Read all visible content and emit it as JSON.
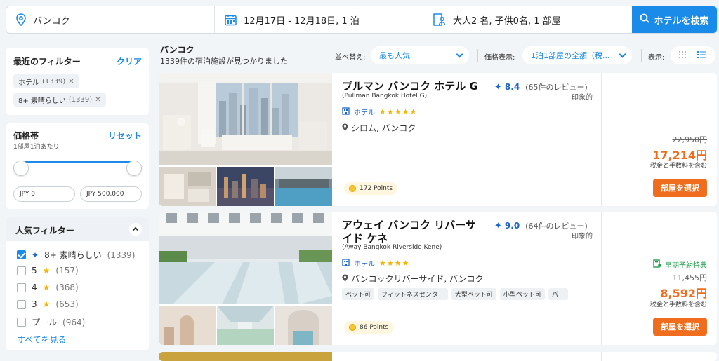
{
  "search": {
    "destination": "バンコク",
    "dates": "12月17日 - 12月18日, 1 泊",
    "guests": "大人2 名, 子供0名, 1 部屋",
    "button": "ホテルを検索"
  },
  "sidebar": {
    "recent_filters": {
      "title": "最近のフィルター",
      "clear": "クリア",
      "chips": [
        {
          "label": "ホテル",
          "count": "(1339)"
        },
        {
          "label": "8+ 素晴らしい",
          "count": "(1339)"
        }
      ]
    },
    "price": {
      "title": "価格帯",
      "reset": "リセット",
      "note": "1部屋1泊あたり",
      "min": "JPY 0",
      "max": "JPY 500,000"
    },
    "popular": {
      "title": "人気フィルター",
      "items": [
        {
          "label": "8+ 素晴らしい",
          "count": "(1339)"
        },
        {
          "label": "5",
          "count": "(157)"
        },
        {
          "label": "4",
          "count": "(368)"
        },
        {
          "label": "3",
          "count": "(653)"
        },
        {
          "label": "プール",
          "count": "(964)"
        }
      ],
      "see_all": "すべてを見る"
    }
  },
  "results": {
    "city": "バンコク",
    "count": "1339件の宿泊施設が見つかりました",
    "sort_label": "並べ替え:",
    "sort_value": "最も人気",
    "price_label": "価格表示:",
    "price_value": "1泊1部屋の全額（税...",
    "view_label": "表示:"
  },
  "hotels": [
    {
      "name": "プルマン バンコク ホテル G",
      "name_en": "(Pullman Bangkok Hotel G)",
      "score": "8.4",
      "reviews": "(65件のレビュー)",
      "impression": "印象的",
      "type": "ホテル",
      "stars": "★★★★★",
      "location": "シロム, バンコク",
      "points": "172 Points",
      "old_price": "22,950円",
      "price": "17,214円",
      "tax": "税金と手数料を含む",
      "book": "部屋を選択"
    },
    {
      "name": "アウェイ バンコク リバーサイド ケネ",
      "name_en": "(Away Bangkok Riverside Kene)",
      "score": "9.0",
      "reviews": "(64件のレビュー)",
      "impression": "印象的",
      "type": "ホテル",
      "stars": "★★★★",
      "location": "バンコックリバーサイド, バンコク",
      "amenities": [
        "ペット可",
        "フィットネスセンター",
        "大型ペット可",
        "小型ペット可",
        "バー"
      ],
      "points": "86 Points",
      "early": "早期予約特典",
      "old_price": "11,455円",
      "price": "8,592円",
      "tax": "税金と手数料を含む",
      "book": "部屋を選択"
    }
  ]
}
